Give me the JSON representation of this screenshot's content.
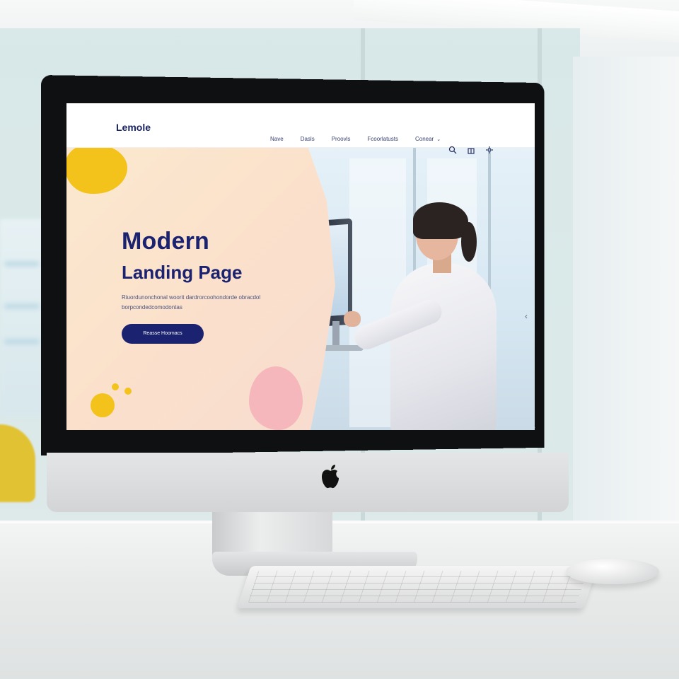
{
  "site": {
    "brand": "Lemole",
    "nav": {
      "links": [
        "Nave",
        "Dasls",
        "Proovls",
        "Fcoorlatusts",
        "Conear"
      ],
      "icons": [
        "search-icon",
        "gift-icon",
        "settings-icon"
      ]
    },
    "hero": {
      "title": "Modern",
      "subtitle": "Landing Page",
      "body": "Riuordunonchonal woorit dardrorcoohondorde obracdol borpcondedcomodontas",
      "cta": "Reasse Hoomacs"
    }
  },
  "device": {
    "logo": "apple-logo"
  },
  "colors": {
    "brand_navy": "#1b2370",
    "accent_yellow": "#f3c31c",
    "accent_pink": "#f6b7bc",
    "hero_peach": "#fbe1cb"
  }
}
